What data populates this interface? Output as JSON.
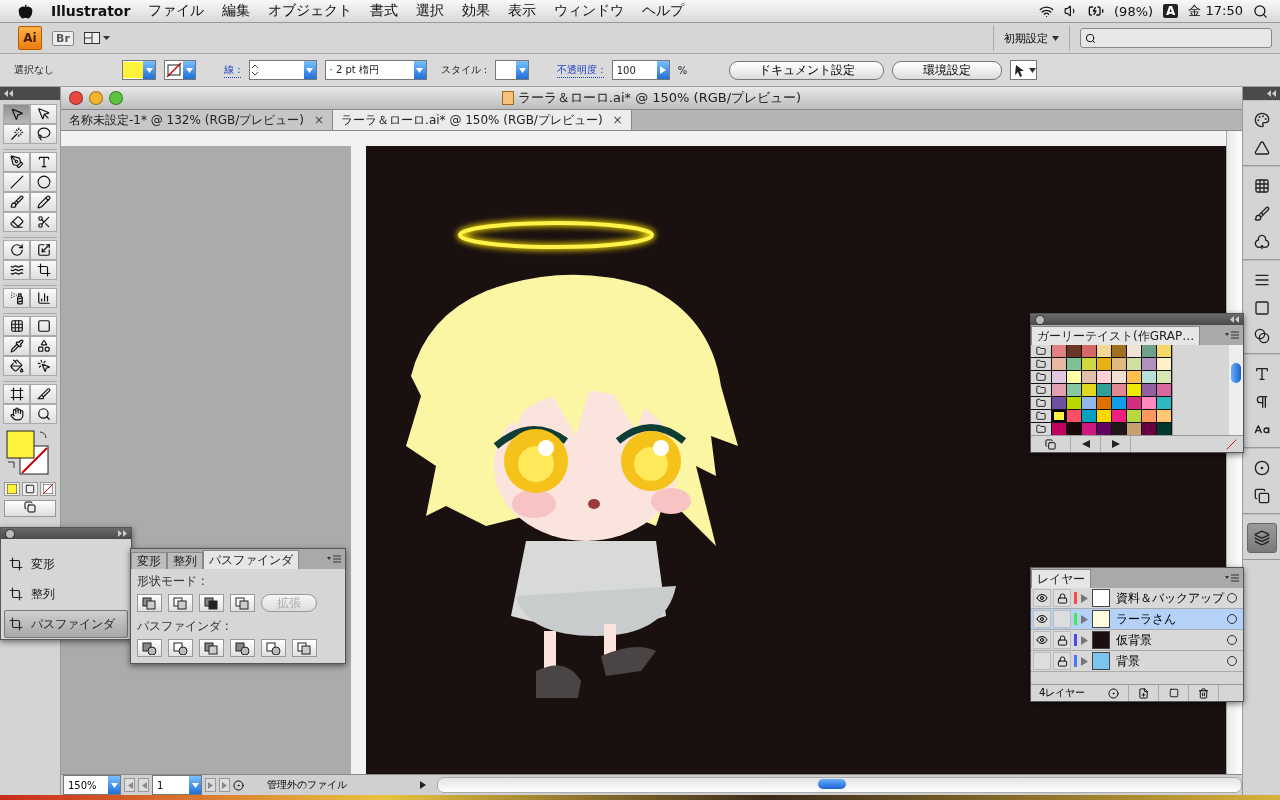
{
  "menu_bar": {
    "app": "Illustrator",
    "items": [
      "ファイル",
      "編集",
      "オブジェクト",
      "書式",
      "選択",
      "効果",
      "表示",
      "ウィンドウ",
      "ヘルプ"
    ],
    "battery": "(98%)",
    "input_mode": "A",
    "clock": "金 17:50"
  },
  "app_bar": {
    "logo": "Ai",
    "bridge": "Br",
    "workspace": "初期設定"
  },
  "control_bar": {
    "selection": "選択なし",
    "stroke_label": "線 :",
    "brush": "·  2 pt 楕円",
    "style_label": "スタイル :",
    "opacity_label": "不透明度 :",
    "opacity": "100",
    "percent": "%",
    "buttons": [
      "ドキュメント設定",
      "環境設定"
    ]
  },
  "tools": [
    {
      "selected": true
    },
    {
      "selected": false
    },
    {
      "selected": false
    },
    {
      "selected": false
    },
    {
      "selected": false
    },
    {
      "selected": false
    },
    {
      "selected": false
    },
    {
      "selected": false
    },
    {
      "selected": false
    },
    {
      "selected": false
    },
    {
      "selected": false
    },
    {
      "selected": false
    },
    {
      "selected": false
    },
    {
      "selected": false
    },
    {
      "selected": false
    },
    {
      "selected": false
    },
    {
      "selected": false
    },
    {
      "selected": false
    },
    {
      "selected": false
    },
    {
      "selected": false
    },
    {
      "selected": false
    },
    {
      "selected": false
    },
    {
      "selected": false
    },
    {
      "selected": false
    },
    {
      "selected": false
    },
    {
      "selected": false
    },
    {
      "selected": false
    },
    {
      "selected": false
    }
  ],
  "document": {
    "title": "ラーラ＆ローロ.ai* @ 150% (RGB/プレビュー)",
    "tabs": [
      {
        "label": "名称未設定-1* @ 132% (RGB/プレビュー)",
        "close": "×",
        "selected": false
      },
      {
        "label": "ラーラ＆ローロ.ai* @ 150% (RGB/プレビュー)",
        "close": "×",
        "selected": true
      }
    ],
    "zoom": "150%",
    "page": "1",
    "status": "管理外のファイル"
  },
  "panel_dock": {
    "items": [
      {
        "label": "変形",
        "selected": false
      },
      {
        "label": "整列",
        "selected": false
      },
      {
        "label": "パスファインダ",
        "selected": true
      }
    ]
  },
  "pathfinder": {
    "tabs": [
      {
        "label": "変形",
        "selected": false
      },
      {
        "label": "整列",
        "selected": false
      },
      {
        "label": "パスファインダ",
        "selected": true
      }
    ],
    "shape_modes_label": "形状モード :",
    "pathfinders_label": "パスファインダ :",
    "expand": {
      "label": "拡張",
      "disabled": true
    }
  },
  "swatches": {
    "title": "ガーリーテイスト(作GRAP…",
    "items": [
      {
        "color": "#e08080",
        "selected": false
      },
      {
        "color": "#6b3525",
        "selected": false
      },
      {
        "color": "#d86868",
        "selected": false
      },
      {
        "color": "#f5d898",
        "selected": false
      },
      {
        "color": "#a07020",
        "selected": false
      },
      {
        "color": "#f0e5d5",
        "selected": false
      },
      {
        "color": "#70a088",
        "selected": false
      },
      {
        "color": "#f5d868",
        "selected": false
      },
      {
        "color": "#e8b8a0",
        "selected": false
      },
      {
        "color": "#80c098",
        "selected": false
      },
      {
        "color": "#d0d840",
        "selected": false
      },
      {
        "color": "#e8b010",
        "selected": false
      },
      {
        "color": "#e0b880",
        "selected": false
      },
      {
        "color": "#d0e0a0",
        "selected": false
      },
      {
        "color": "#b090c0",
        "selected": false
      },
      {
        "color": "#fff0c8",
        "selected": false
      },
      {
        "color": "#e0c8e0",
        "selected": false
      },
      {
        "color": "#ffffa8",
        "selected": false
      },
      {
        "color": "#e0c0a8",
        "selected": false
      },
      {
        "color": "#ffd0d8",
        "selected": false
      },
      {
        "color": "#f0e0d0",
        "selected": false
      },
      {
        "color": "#ffc050",
        "selected": false
      },
      {
        "color": "#b8e0d8",
        "selected": false
      },
      {
        "color": "#d8e8b0",
        "selected": false
      },
      {
        "color": "#e0a0b0",
        "selected": false
      },
      {
        "color": "#88c8a0",
        "selected": false
      },
      {
        "color": "#e0d820",
        "selected": false
      },
      {
        "color": "#30a098",
        "selected": false
      },
      {
        "color": "#e08890",
        "selected": false
      },
      {
        "color": "#f0e800",
        "selected": false
      },
      {
        "color": "#9060a0",
        "selected": false
      },
      {
        "color": "#d868a0",
        "selected": false
      },
      {
        "color": "#7050a0",
        "selected": false
      },
      {
        "color": "#b8d800",
        "selected": false
      },
      {
        "color": "#90b8e8",
        "selected": false
      },
      {
        "color": "#e07000",
        "selected": false
      },
      {
        "color": "#10a0e8",
        "selected": false
      },
      {
        "color": "#d03080",
        "selected": false
      },
      {
        "color": "#ff88c0",
        "selected": false
      },
      {
        "color": "#30b8c0",
        "selected": false
      },
      {
        "color": "#fff040",
        "selected": true
      },
      {
        "color": "#ff5068",
        "selected": false
      },
      {
        "color": "#00a0c0",
        "selected": false
      },
      {
        "color": "#ffd800",
        "selected": false
      },
      {
        "color": "#f02080",
        "selected": false
      },
      {
        "color": "#b8d840",
        "selected": false
      },
      {
        "color": "#ff9860",
        "selected": false
      },
      {
        "color": "#ffc870",
        "selected": false
      },
      {
        "color": "#c00060",
        "selected": false
      },
      {
        "color": "#180808",
        "selected": false
      },
      {
        "color": "#d01880",
        "selected": false
      },
      {
        "color": "#600060",
        "selected": false
      },
      {
        "color": "#201818",
        "selected": false
      },
      {
        "color": "#c8a070",
        "selected": false
      },
      {
        "color": "#680040",
        "selected": false
      },
      {
        "color": "#003830",
        "selected": false
      }
    ]
  },
  "layers": {
    "title": "レイヤー",
    "count": "4レイヤー",
    "items": [
      {
        "name": "資料＆バックアップ",
        "visible": true,
        "locked": true,
        "color": "#ff4848",
        "selected": false
      },
      {
        "name": "ラーラさん",
        "visible": true,
        "locked": false,
        "color": "#48e848",
        "selected": true
      },
      {
        "name": "仮背景",
        "visible": true,
        "locked": true,
        "color": "#4a4aff",
        "selected": false
      },
      {
        "name": "背景",
        "visible": false,
        "locked": true,
        "color": "#4a78ff",
        "selected": false
      }
    ]
  },
  "dock": [
    {
      "selected": false
    },
    {
      "selected": false
    },
    {
      "selected": false
    },
    {
      "selected": false
    },
    {
      "selected": false
    },
    {
      "selected": false
    },
    {
      "selected": false
    },
    {
      "selected": false
    },
    {
      "selected": false
    },
    {
      "selected": false
    },
    {
      "selected": false
    },
    {
      "selected": false
    },
    {
      "selected": false
    },
    {
      "selected": true
    }
  ]
}
